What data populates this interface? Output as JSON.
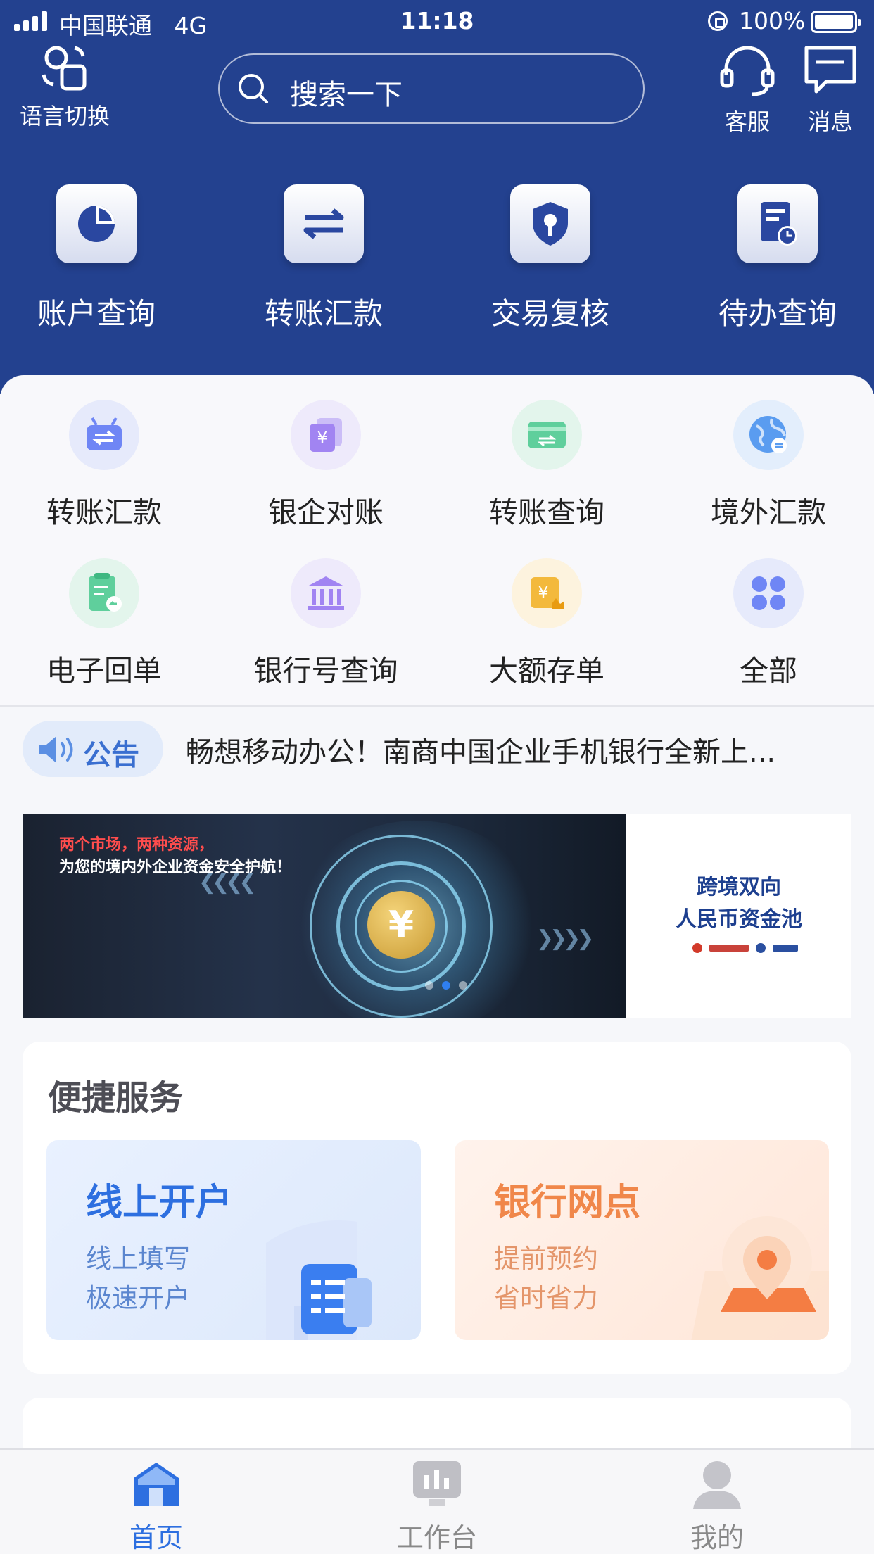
{
  "status_bar": {
    "carrier": "中国联通",
    "network": "4G",
    "time": "11:18",
    "battery": "100%"
  },
  "header": {
    "language_label": "语言切换",
    "search_placeholder": "搜索一下",
    "service_label": "客服",
    "message_label": "消息"
  },
  "quick_menu": [
    {
      "label": "账户查询",
      "icon": "pie-chart-icon"
    },
    {
      "label": "转账汇款",
      "icon": "transfer-arrows-icon"
    },
    {
      "label": "交易复核",
      "icon": "shield-key-icon"
    },
    {
      "label": "待办查询",
      "icon": "document-clock-icon"
    }
  ],
  "function_grid": [
    {
      "label": "转账汇款",
      "icon": "robot-transfer-icon",
      "color": "#6f86f5"
    },
    {
      "label": "银企对账",
      "icon": "yuan-cards-icon",
      "color": "#a184f2"
    },
    {
      "label": "转账查询",
      "icon": "card-transfer-icon",
      "color": "#5fcf9c"
    },
    {
      "label": "境外汇款",
      "icon": "globe-icon",
      "color": "#5a9cf0"
    },
    {
      "label": "电子回单",
      "icon": "receipt-return-icon",
      "color": "#5fcf9c"
    },
    {
      "label": "银行号查询",
      "icon": "bank-building-icon",
      "color": "#a184f2"
    },
    {
      "label": "大额存单",
      "icon": "yuan-certificate-icon",
      "color": "#f3b93c"
    },
    {
      "label": "全部",
      "icon": "grid-all-icon",
      "color": "#6f86f5"
    }
  ],
  "notice": {
    "badge": "公告",
    "text": "畅想移动办公！南商中国企业手机银行全新上..."
  },
  "banner": {
    "line1": "两个市场，两种资源，",
    "line2": "为您的境内外企业资金安全护航！",
    "title_line1": "跨境双向",
    "title_line2": "人民币资金池",
    "coin_symbol": "¥"
  },
  "services": {
    "title": "便捷服务",
    "items": [
      {
        "title": "线上开户",
        "line1": "线上填写",
        "line2": "极速开户"
      },
      {
        "title": "银行网点",
        "line1": "提前预约",
        "line2": "省时省力"
      }
    ]
  },
  "tabbar": {
    "items": [
      {
        "label": "首页",
        "active": true
      },
      {
        "label": "工作台",
        "active": false
      },
      {
        "label": "我的",
        "active": false
      }
    ]
  },
  "colors": {
    "header_blue": "#23418f",
    "accent_blue": "#2d6fe0",
    "accent_orange": "#f0874a"
  }
}
